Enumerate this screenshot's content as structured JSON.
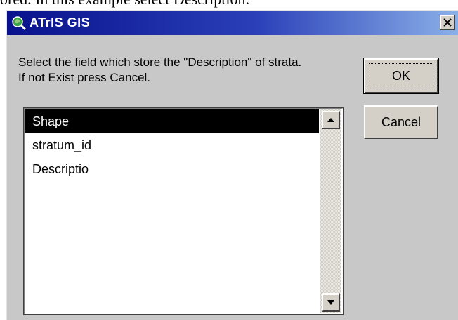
{
  "document": {
    "text_above": "ored. In this example select Description."
  },
  "dialog": {
    "title": "ATrIS GIS",
    "icons": {
      "app": "globe-magnifier-icon",
      "close": "close-icon"
    },
    "prompt_line1": "Select the field which store the \"Description\" of strata.",
    "prompt_line2": "If not Exist press Cancel.",
    "ok_label": "OK",
    "cancel_label": "Cancel",
    "fields": [
      {
        "label": "Shape",
        "selected": true
      },
      {
        "label": "stratum_id",
        "selected": false
      },
      {
        "label": "Descriptio",
        "selected": false
      }
    ],
    "colors": {
      "titlebar_start": "#08128c",
      "titlebar_end": "#8ab0e8",
      "dialog_bg": "#c8c8c8",
      "selection_bg": "#000000"
    }
  }
}
